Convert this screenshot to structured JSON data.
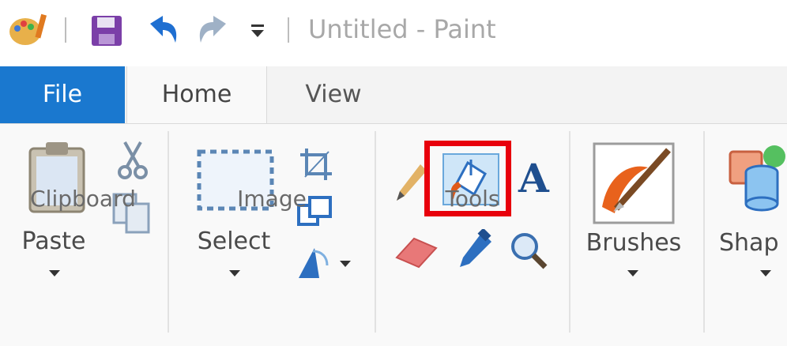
{
  "window": {
    "title": "Untitled - Paint"
  },
  "tabs": [
    {
      "label": "File"
    },
    {
      "label": "Home"
    },
    {
      "label": "View"
    }
  ],
  "groups": {
    "clipboard": {
      "label": "Clipboard",
      "paste_label": "Paste"
    },
    "image": {
      "label": "Image",
      "select_label": "Select"
    },
    "tools": {
      "label": "Tools",
      "text_tool_glyph": "A"
    },
    "brushes": {
      "label": "Brushes"
    },
    "shapes": {
      "label": "Shap"
    }
  },
  "colors": {
    "file_tab": "#1a78cf",
    "highlight": "#e8000c",
    "selected_tool_bg": "#cfe6f8"
  },
  "icons": [
    "paint-app-icon",
    "save-icon",
    "undo-icon",
    "redo-icon",
    "customize-quick-access-icon",
    "clipboard-icon",
    "cut-icon",
    "copy-icon",
    "select-rectangle-icon",
    "crop-icon",
    "resize-icon",
    "rotate-icon",
    "pencil-icon",
    "fill-bucket-icon",
    "text-icon",
    "eraser-icon",
    "color-picker-icon",
    "magnifier-icon",
    "brushes-icon",
    "shapes-icon"
  ]
}
